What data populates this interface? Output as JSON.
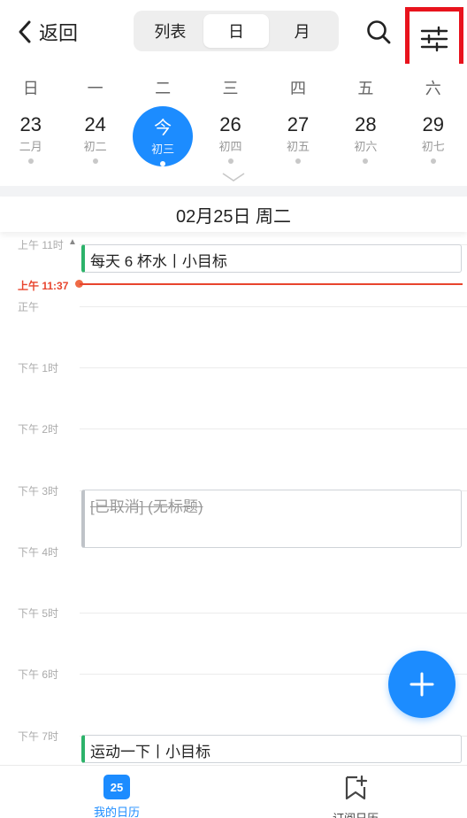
{
  "header": {
    "back_label": "返回",
    "view_options": [
      "列表",
      "日",
      "月"
    ],
    "active_view": "日"
  },
  "week": {
    "weekdays": [
      "日",
      "一",
      "二",
      "三",
      "四",
      "五",
      "六"
    ],
    "days": [
      {
        "num": "23",
        "lunar": "二月"
      },
      {
        "num": "24",
        "lunar": "初二"
      },
      {
        "num": "今",
        "lunar": "初三"
      },
      {
        "num": "26",
        "lunar": "初四"
      },
      {
        "num": "27",
        "lunar": "初五"
      },
      {
        "num": "28",
        "lunar": "初六"
      },
      {
        "num": "29",
        "lunar": "初七"
      }
    ]
  },
  "date_title": "02月25日 周二",
  "timeline": {
    "hours": [
      "上午 11时",
      "正午",
      "下午 1时",
      "下午 2时",
      "下午 3时",
      "下午 4时",
      "下午 5时",
      "下午 6时",
      "下午 7时"
    ],
    "now_label": "上午 11:37",
    "events": [
      {
        "title": "每天 6 杯水丨小目标"
      },
      {
        "title": "[已取消] (无标题)"
      },
      {
        "title": "运动一下丨小目标"
      }
    ]
  },
  "bottom_nav": {
    "my_calendar": "我的日历",
    "badge": "25",
    "subscribe": "订阅日历"
  },
  "colors": {
    "accent": "#1c8cff",
    "now_line": "#e8452e",
    "event_green": "#2db36a",
    "highlight_box": "#e8131d"
  }
}
